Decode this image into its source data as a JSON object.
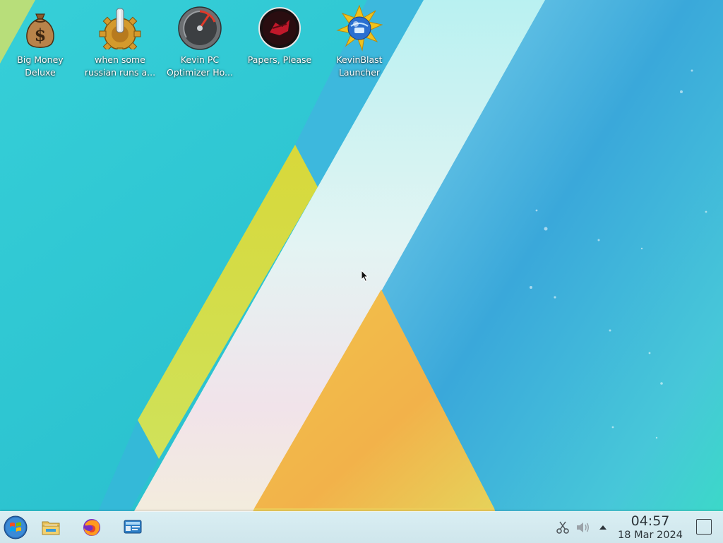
{
  "wallpaper": {
    "colors": {
      "teal": "#2fc6d3",
      "cyan_light": "#6fe3e8",
      "blue": "#3fb0df",
      "yellow_green": "#d9dc3a",
      "white_band": "#e8f6f3",
      "orange": "#f0b84a",
      "aqua": "#33d6cb"
    }
  },
  "desktop_icons": [
    {
      "name": "money-bag-icon",
      "line1": "Big Money",
      "line2": "Deluxe"
    },
    {
      "name": "gear-joystick-icon",
      "line1": "when some",
      "line2": "russian runs a..."
    },
    {
      "name": "speedometer-icon",
      "line1": "Kevin PC",
      "line2": "Optimizer Ho..."
    },
    {
      "name": "papers-please-icon",
      "line1": "Papers, Please",
      "line2": ""
    },
    {
      "name": "blast-globe-icon",
      "line1": "KevinBlast",
      "line2": "Launcher"
    }
  ],
  "taskbar": {
    "launchers": [
      {
        "name": "start-menu-icon"
      },
      {
        "name": "file-manager-icon"
      },
      {
        "name": "firefox-icon"
      },
      {
        "name": "system-settings-icon"
      }
    ],
    "tray": [
      {
        "name": "scissors-icon"
      },
      {
        "name": "volume-icon"
      },
      {
        "name": "tray-expand-icon"
      }
    ],
    "clock": {
      "time": "04:57",
      "date": "18 Mar 2024"
    }
  }
}
